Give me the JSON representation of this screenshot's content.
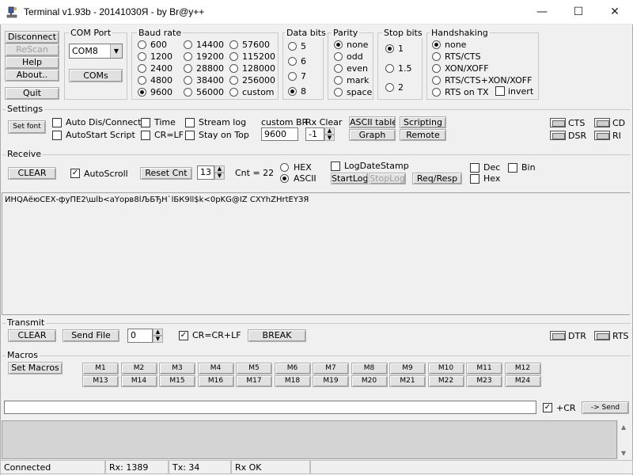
{
  "window": {
    "title": "Terminal v1.93b - 20141030Я - by Br@y++"
  },
  "left_buttons": {
    "disconnect": "Disconnect",
    "rescan": "ReScan",
    "help": "Help",
    "about": "About..",
    "quit": "Quit"
  },
  "com_port": {
    "title": "COM Port",
    "value": "COM8",
    "coms": "COMs"
  },
  "baud": {
    "title": "Baud rate",
    "options": [
      "600",
      "1200",
      "2400",
      "4800",
      "9600",
      "14400",
      "19200",
      "28800",
      "38400",
      "56000",
      "57600",
      "115200",
      "128000",
      "256000",
      "custom"
    ],
    "selected": "9600"
  },
  "data_bits": {
    "title": "Data bits",
    "options": [
      "5",
      "6",
      "7",
      "8"
    ],
    "selected": "8"
  },
  "parity": {
    "title": "Parity",
    "options": [
      "none",
      "odd",
      "even",
      "mark",
      "space"
    ],
    "selected": "none"
  },
  "stop_bits": {
    "title": "Stop bits",
    "options": [
      "1",
      "1.5",
      "2"
    ],
    "selected": "1"
  },
  "handshaking": {
    "title": "Handshaking",
    "options": [
      "none",
      "RTS/CTS",
      "XON/XOFF",
      "RTS/CTS+XON/XOFF",
      "RTS on TX"
    ],
    "selected": "none",
    "invert": "invert"
  },
  "settings": {
    "title": "Settings",
    "set_font": "Set font",
    "auto_dis_connect": "Auto Dis/Connect",
    "autostart_script": "AutoStart Script",
    "time": "Time",
    "cr_lf": "CR=LF",
    "stream_log": "Stream log",
    "stay_on_top": "Stay on Top",
    "custom_br_label": "custom BR",
    "custom_br_value": "9600",
    "rx_clear_label": "Rx Clear",
    "rx_clear_value": "-1",
    "ascii_table": "ASCII table",
    "graph": "Graph",
    "scripting": "Scripting",
    "remote": "Remote",
    "cts": "CTS",
    "cd": "CD",
    "dsr": "DSR",
    "ri": "RI"
  },
  "receive": {
    "title": "Receive",
    "clear": "CLEAR",
    "autoscroll": "AutoScroll",
    "reset_cnt": "Reset Cnt",
    "cnt_value": "13",
    "cnt_label": "Cnt = 22",
    "hex": "HEX",
    "ascii": "ASCII",
    "log_date_stamp": "LogDateStamp",
    "start_log": "StartLog",
    "stop_log": "StopLog",
    "req_resp": "Req/Resp",
    "dec": "Dec",
    "bin": "Bin",
    "hex2": "Hex",
    "content": "ИНQАёюСЕХ-фуПЕ2\\шlb<аYорв8lЉБЂН`lБК9ll$k<0рKG@IZ CXYhZHrtЕҮЗЯ"
  },
  "transmit": {
    "title": "Transmit",
    "clear": "CLEAR",
    "send_file": "Send File",
    "count": "0",
    "cr_crlf": "CR=CR+LF",
    "break": "BREAK",
    "dtr": "DTR",
    "rts": "RTS"
  },
  "macros": {
    "title": "Macros",
    "set_macros": "Set Macros",
    "row1": [
      "M1",
      "M2",
      "M3",
      "M4",
      "M5",
      "M6",
      "M7",
      "M8",
      "M9",
      "M10",
      "M11",
      "M12"
    ],
    "row2": [
      "M13",
      "M14",
      "M15",
      "M16",
      "M17",
      "M18",
      "M19",
      "M20",
      "M21",
      "M22",
      "M23",
      "M24"
    ]
  },
  "send_bar": {
    "cr_label": "+CR",
    "send": "-> Send",
    "input_value": ""
  },
  "status": {
    "connected": "Connected",
    "rx": "Rx: 1389",
    "tx": "Tx: 34",
    "rx_ok": "Rx OK"
  }
}
